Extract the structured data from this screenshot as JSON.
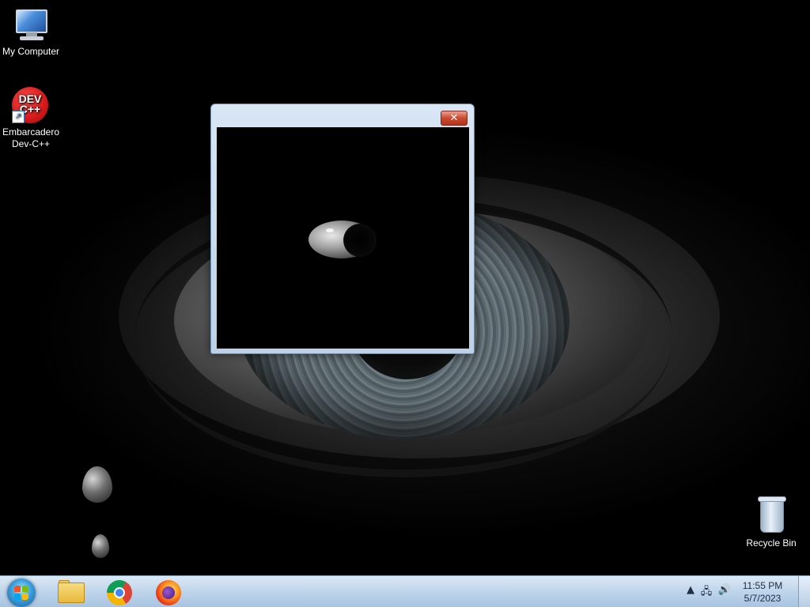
{
  "desktop": {
    "icons": [
      {
        "label": "My Computer",
        "icon": "computer-icon"
      },
      {
        "label": "Embarcadero Dev-C++",
        "icon": "devcpp-icon",
        "badge_text": "DEV C++"
      },
      {
        "label": "Recycle Bin",
        "icon": "recycle-bin-icon"
      }
    ]
  },
  "window": {
    "close_label": "✕"
  },
  "taskbar": {
    "pinned": [
      {
        "name": "File Explorer",
        "icon": "folder-icon"
      },
      {
        "name": "Google Chrome",
        "icon": "chrome-icon"
      },
      {
        "name": "Firefox",
        "icon": "firefox-icon"
      }
    ],
    "tray": {
      "arrow": "▲",
      "network": "🖧",
      "volume": "🔊",
      "time": "11:55 PM",
      "date": "5/7/2023"
    }
  },
  "colors": {
    "taskbar": "#bcd3ea",
    "window_frame": "#bcd2ea",
    "close_button": "#c94a2f",
    "client_background": "#000000"
  }
}
